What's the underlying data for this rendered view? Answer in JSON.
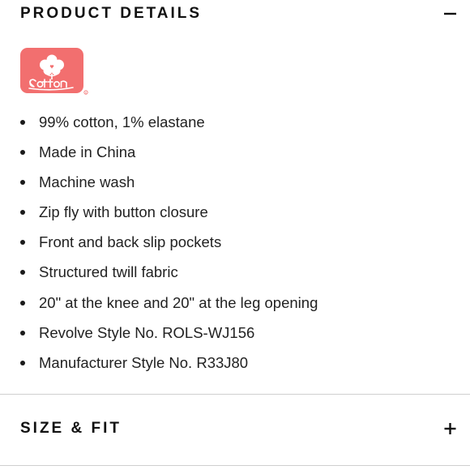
{
  "product_details": {
    "title": "PRODUCT DETAILS",
    "toggle_icon": "minus-icon",
    "badge": {
      "text": "cotton",
      "color": "#f26f6f"
    },
    "features": [
      "99% cotton, 1% elastane",
      "Made in China",
      "Machine wash",
      "Zip fly with button closure",
      "Front and back slip pockets",
      "Structured twill fabric",
      "20\" at the knee and 20\" at the leg opening",
      "Revolve Style No. ROLS-WJ156",
      "Manufacturer Style No. R33J80"
    ]
  },
  "size_fit": {
    "title": "SIZE & FIT",
    "toggle_icon": "plus-icon"
  }
}
